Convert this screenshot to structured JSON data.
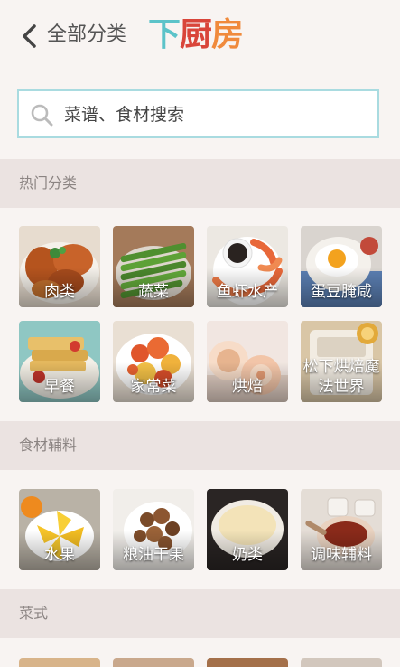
{
  "header": {
    "back_icon": "chevron-left-icon",
    "title": "全部分类",
    "logo_chars": [
      "下",
      "厨",
      "房"
    ],
    "logo_colors": [
      "#5cc3c9",
      "#d9453a",
      "#f08a3c"
    ]
  },
  "search": {
    "icon": "search-icon",
    "placeholder": "菜谱、食材搜索"
  },
  "sections": [
    {
      "title": "热门分类",
      "items": [
        {
          "label": "肉类"
        },
        {
          "label": "蔬菜"
        },
        {
          "label": "鱼虾水产"
        },
        {
          "label": "蛋豆腌咸"
        },
        {
          "label": "早餐"
        },
        {
          "label": "家常菜"
        },
        {
          "label": "烘焙"
        },
        {
          "label": "松下烘焙魔法世界"
        }
      ]
    },
    {
      "title": "食材辅料",
      "items": [
        {
          "label": "水果"
        },
        {
          "label": "粮油干果"
        },
        {
          "label": "奶类"
        },
        {
          "label": "调味辅料"
        }
      ]
    },
    {
      "title": "菜式",
      "items": []
    }
  ],
  "colors": {
    "page_bg": "#f8f4f2",
    "section_bg": "#ebe3e1",
    "search_border": "#a9dbe0"
  }
}
